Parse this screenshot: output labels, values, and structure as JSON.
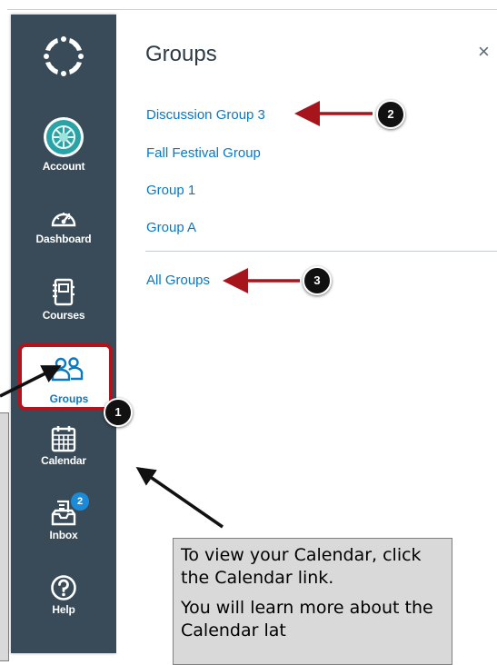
{
  "sidebar": {
    "items": [
      {
        "label": "Account",
        "icon": "account-avatar-icon"
      },
      {
        "label": "Dashboard",
        "icon": "dashboard-gauge-icon"
      },
      {
        "label": "Courses",
        "icon": "courses-book-icon"
      },
      {
        "label": "Groups",
        "icon": "groups-people-icon"
      },
      {
        "label": "Calendar",
        "icon": "calendar-icon"
      },
      {
        "label": "Inbox",
        "icon": "inbox-tray-icon"
      },
      {
        "label": "Help",
        "icon": "help-question-icon"
      }
    ],
    "inbox_badge": "2"
  },
  "tray": {
    "title": "Groups",
    "close": "×",
    "links": [
      "Discussion Group 3",
      "Fall Festival Group",
      "Group 1",
      "Group A"
    ],
    "all_groups": "All Groups"
  },
  "markers": [
    "1",
    "2",
    "3"
  ],
  "note": {
    "line1": "To view your Calendar, click the Calendar link.",
    "line2": "You will learn more about the Calendar lat"
  },
  "colors": {
    "sidebar": "#394b58",
    "link": "#0a78c2",
    "highlight": "#b5121b",
    "arrow": "#a6141c"
  }
}
